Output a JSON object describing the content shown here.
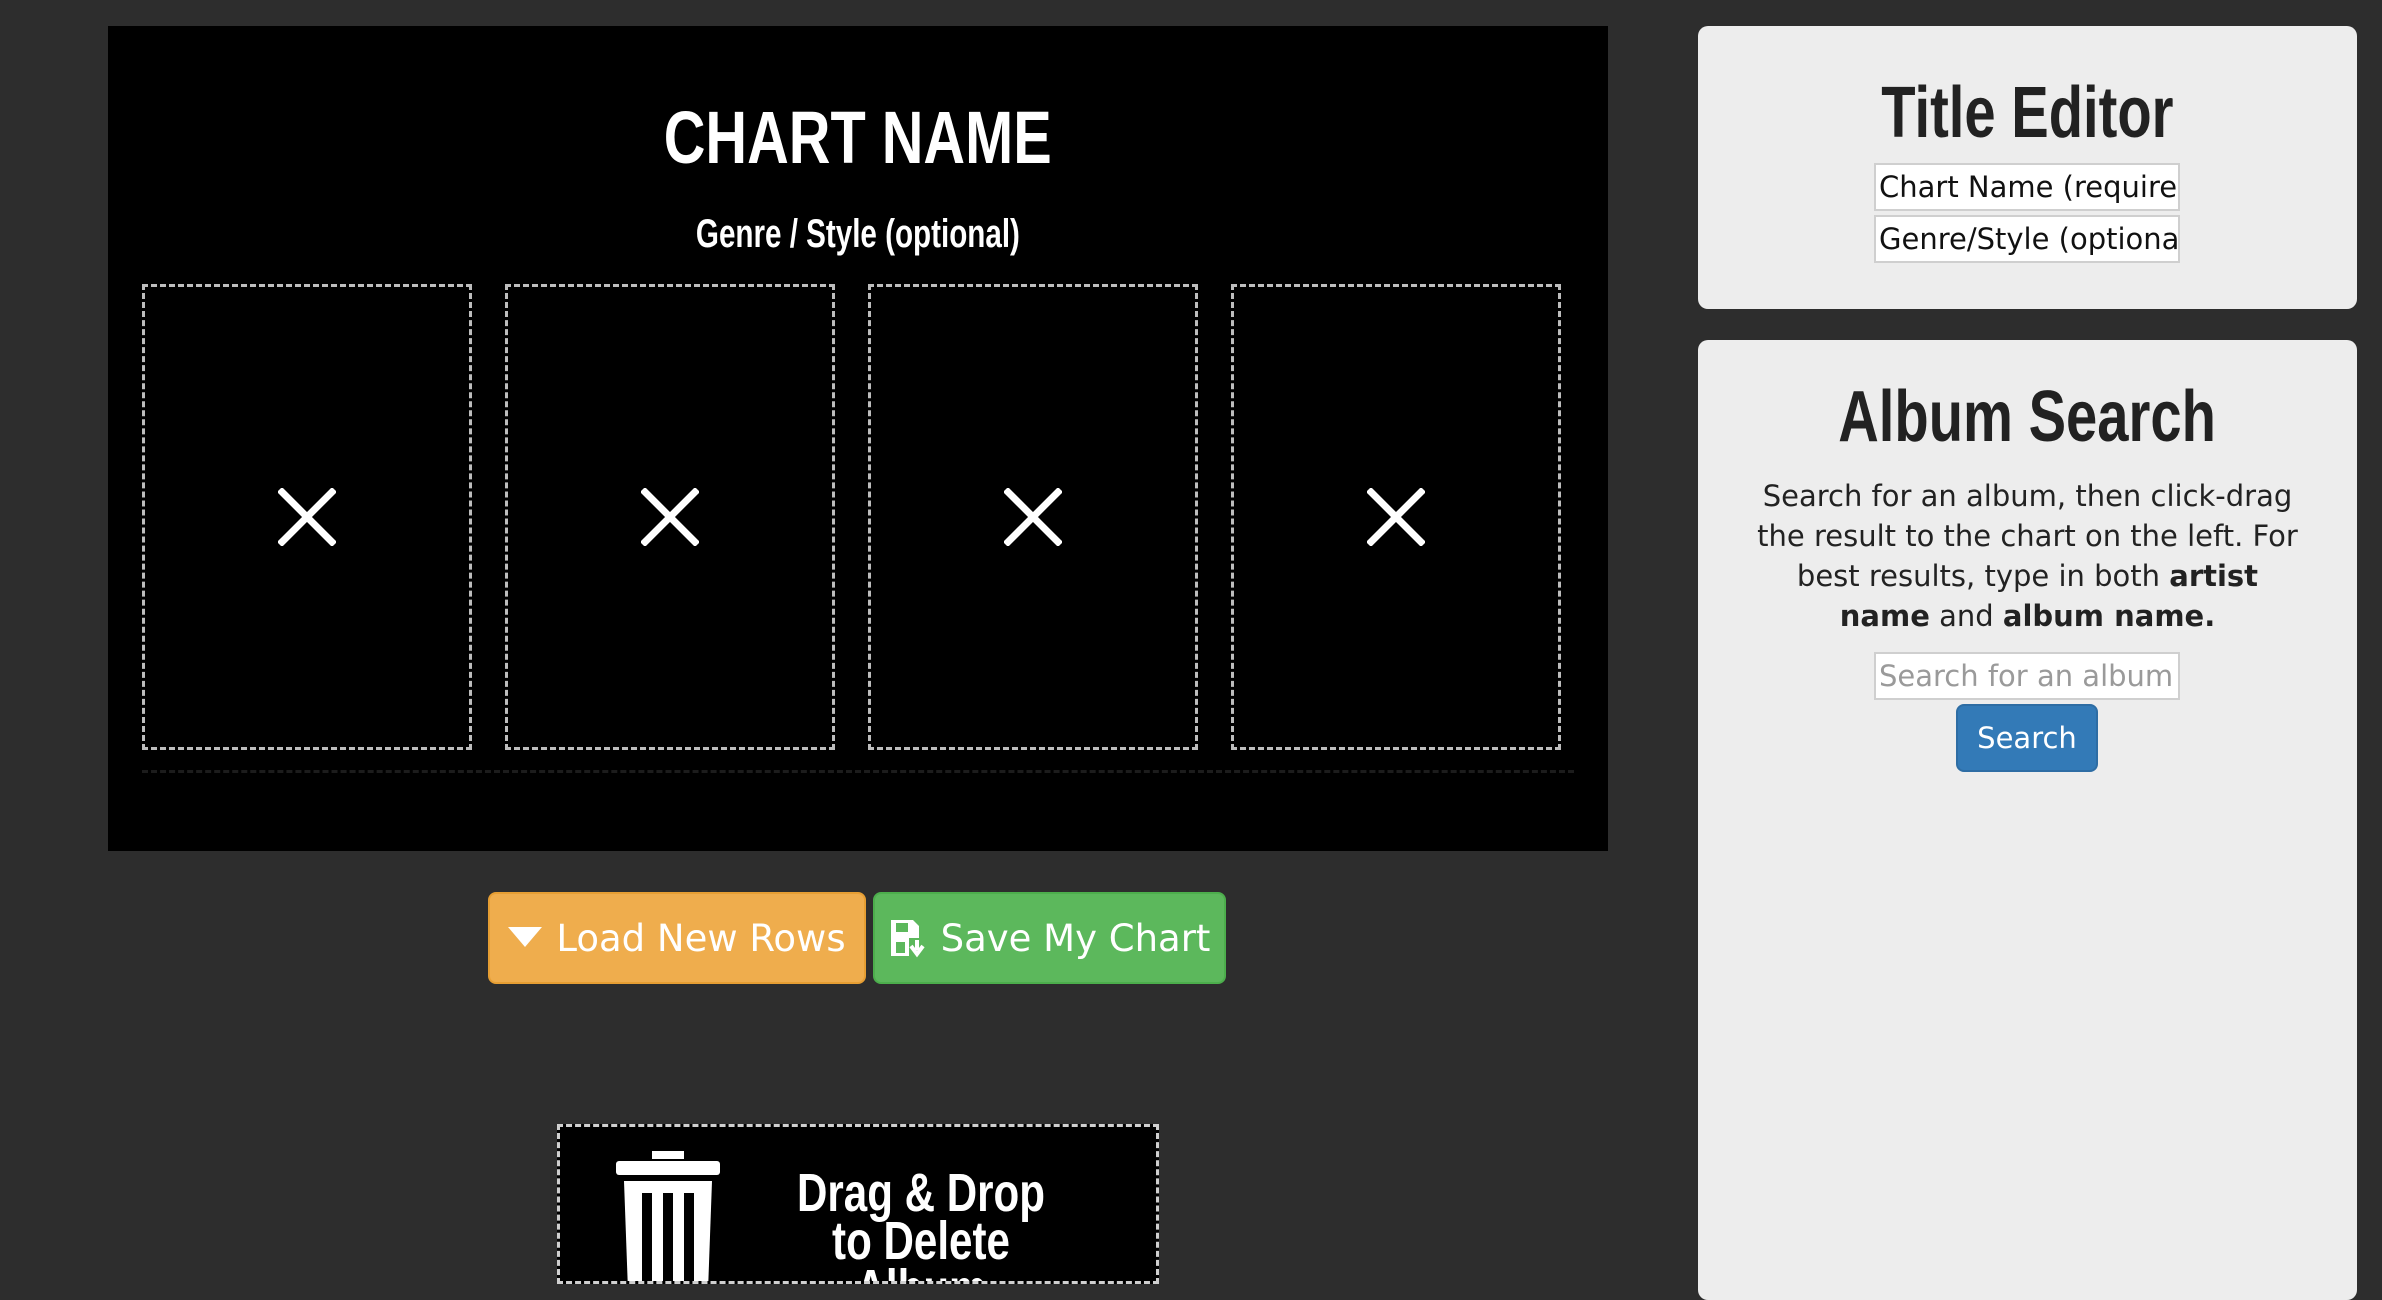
{
  "chart": {
    "title": "CHART NAME",
    "genre": "Genre / Style (optional)",
    "slots": [
      {
        "icon": "close-icon"
      },
      {
        "icon": "close-icon"
      },
      {
        "icon": "close-icon"
      },
      {
        "icon": "close-icon"
      }
    ]
  },
  "buttons": {
    "load_label": "Load New Rows",
    "load_icon": "caret-down-icon",
    "save_label": "Save My Chart",
    "save_icon": "save-icon"
  },
  "trash": {
    "icon": "trash-icon",
    "line1": "Drag & Drop",
    "line2": "to Delete Album"
  },
  "title_editor": {
    "heading": "Title Editor",
    "chart_name_value": "Chart Name (required)",
    "genre_value": "Genre/Style (optional)"
  },
  "album_search": {
    "heading": "Album Search",
    "desc_part1": "Search for an album, then click-drag the result to the chart on the left. For best results, type in both ",
    "desc_bold1": "artist name",
    "desc_part2": " and ",
    "desc_bold2": "album name.",
    "placeholder": "Search for an album",
    "button_label": "Search"
  },
  "colors": {
    "page_bg": "#2d2d2d",
    "chart_bg": "#000000",
    "panel_bg": "#ededed",
    "load_button": "#efad4d",
    "save_button": "#5cb85c",
    "search_button": "#337ab7"
  }
}
